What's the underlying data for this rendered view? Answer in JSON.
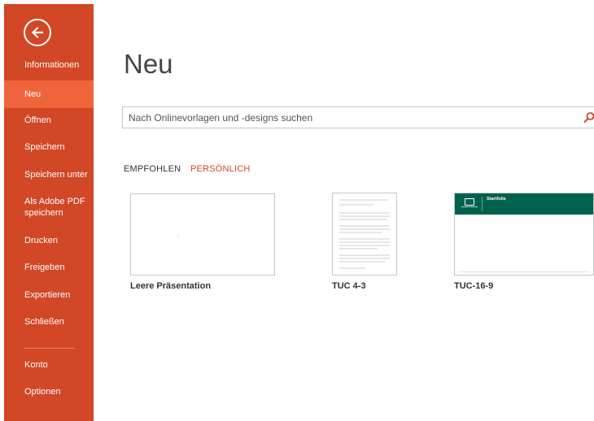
{
  "sidebar": {
    "back_label": "",
    "items": [
      {
        "label": "Informationen"
      },
      {
        "label": "Neu"
      },
      {
        "label": "Öffnen"
      },
      {
        "label": "Speichern"
      },
      {
        "label": "Speichern unter"
      },
      {
        "label": "Als Adobe PDF speichern"
      },
      {
        "label": "Drucken"
      },
      {
        "label": "Freigeben"
      },
      {
        "label": "Exportieren"
      },
      {
        "label": "Schließen"
      },
      {
        "label": "Konto"
      },
      {
        "label": "Optionen"
      }
    ],
    "active": "Neu"
  },
  "main": {
    "title": "Neu",
    "search": {
      "placeholder": "Nach Onlinevorlagen und -designs suchen"
    },
    "categories": [
      {
        "label": "EMPFOHLEN"
      },
      {
        "label": "PERSÖNLICH"
      }
    ],
    "templates": [
      {
        "label": "Leere Präsentation"
      },
      {
        "label": "TUC 4-3"
      },
      {
        "label": "TUC-16-9",
        "header_text": "Startfolie"
      }
    ]
  },
  "colors": {
    "accent": "#d24726",
    "active_item": "#f0643c",
    "template_header": "#00624e"
  }
}
